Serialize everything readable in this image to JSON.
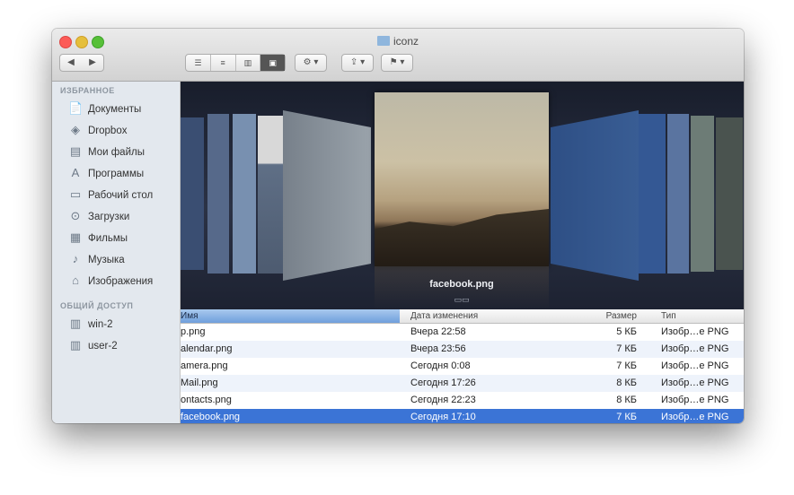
{
  "window": {
    "title": "iconz"
  },
  "toolbar": {
    "back": "◀",
    "forward": "▶",
    "views": [
      "☰",
      "≡",
      "▥",
      "▣"
    ],
    "arrange": "⚙ ▾",
    "share": "⇪ ▾",
    "action": "⚑ ▾"
  },
  "sidebar": {
    "favorites_header": "ИЗБРАННОЕ",
    "favorites": [
      {
        "label": "Документы",
        "icon": "documents-icon",
        "glyph": "📄"
      },
      {
        "label": "Dropbox",
        "icon": "dropbox-icon",
        "glyph": "◈"
      },
      {
        "label": "Мои файлы",
        "icon": "all-files-icon",
        "glyph": "▤"
      },
      {
        "label": "Программы",
        "icon": "applications-icon",
        "glyph": "A"
      },
      {
        "label": "Рабочий стол",
        "icon": "desktop-icon",
        "glyph": "▭"
      },
      {
        "label": "Загрузки",
        "icon": "downloads-icon",
        "glyph": "⊙"
      },
      {
        "label": "Фильмы",
        "icon": "movies-icon",
        "glyph": "▦"
      },
      {
        "label": "Музыка",
        "icon": "music-icon",
        "glyph": "♪"
      },
      {
        "label": "Изображения",
        "icon": "pictures-icon",
        "glyph": "⌂"
      }
    ],
    "shared_header": "ОБЩИЙ ДОСТУП",
    "shared": [
      {
        "label": "win-2",
        "icon": "network-computer-icon",
        "glyph": "▥"
      },
      {
        "label": "user-2",
        "icon": "network-computer-icon",
        "glyph": "▥"
      }
    ]
  },
  "coverflow": {
    "caption": "facebook.png",
    "subcaption": "▭▭"
  },
  "list": {
    "columns": {
      "name": "Имя",
      "date": "Дата изменения",
      "size": "Размер",
      "kind": "Тип"
    },
    "rows": [
      {
        "name": "p.png",
        "date": "Вчера 22:58",
        "size": "5 КБ",
        "kind": "Изобр…е PNG"
      },
      {
        "name": "alendar.png",
        "date": "Вчера 23:56",
        "size": "7 КБ",
        "kind": "Изобр…е PNG"
      },
      {
        "name": "amera.png",
        "date": "Сегодня 0:08",
        "size": "7 КБ",
        "kind": "Изобр…е PNG"
      },
      {
        "name": "Mail.png",
        "date": "Сегодня 17:26",
        "size": "8 КБ",
        "kind": "Изобр…е PNG"
      },
      {
        "name": "ontacts.png",
        "date": "Сегодня 22:23",
        "size": "8 КБ",
        "kind": "Изобр…е PNG"
      },
      {
        "name": "facebook.png",
        "date": "Сегодня 17:10",
        "size": "7 КБ",
        "kind": "Изобр…е PNG"
      }
    ]
  },
  "colors": {
    "selection": "#3b74d6",
    "sidebar_bg": "#e3e8ee",
    "coverflow_bg": "#1d2231"
  }
}
